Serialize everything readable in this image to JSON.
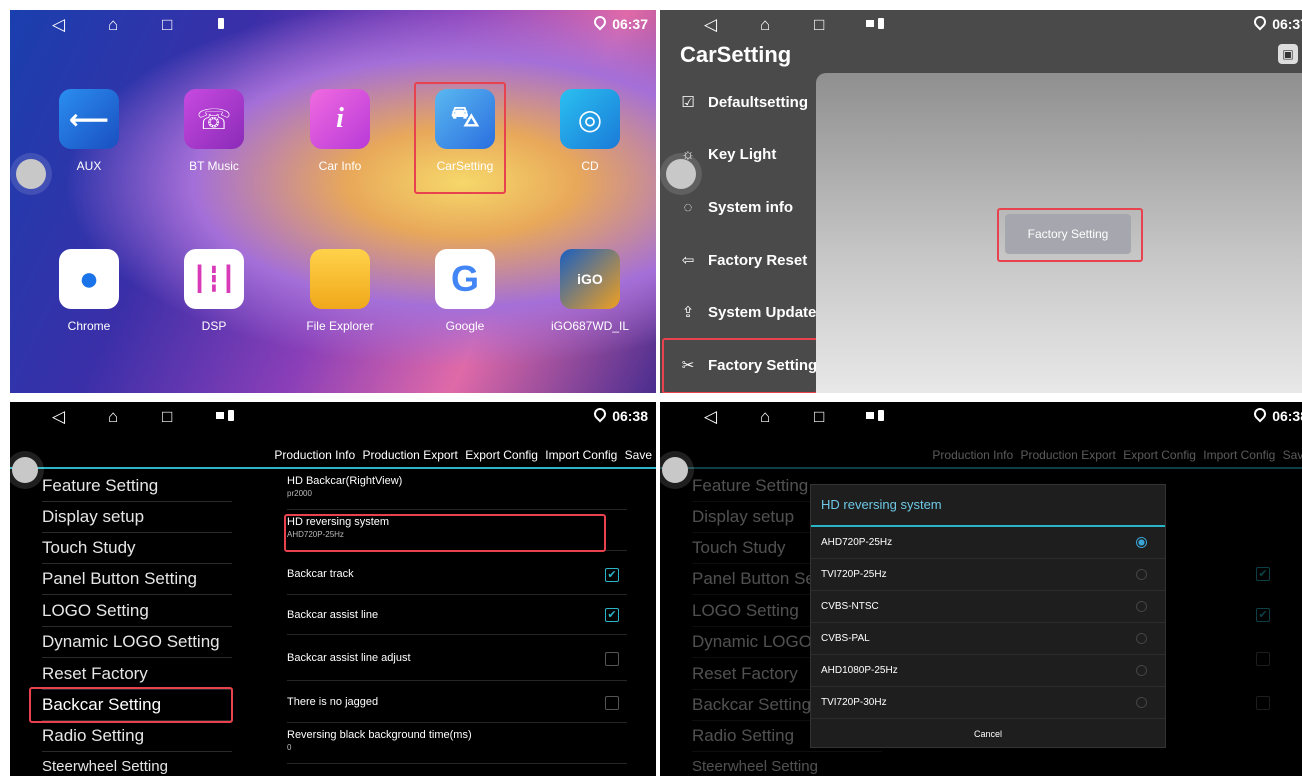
{
  "status": {
    "time_top_left": "06:37",
    "time_top_right": "06:37",
    "time_bottom_left": "06:38",
    "time_bottom_right": "06:38"
  },
  "launcher": {
    "apps": [
      {
        "label": "AUX",
        "icon": "aux-icon",
        "color": "#1e6fd8"
      },
      {
        "label": "BT Music",
        "icon": "bluetooth-music-icon",
        "color": "#b83ad0"
      },
      {
        "label": "Car Info",
        "icon": "info-icon",
        "color": "#d84ad8"
      },
      {
        "label": "CarSetting",
        "icon": "car-icon",
        "color": "#3a8ee8"
      },
      {
        "label": "CD",
        "icon": "cd-icon",
        "color": "#1aa6d8"
      },
      {
        "label": "Chrome",
        "icon": "chrome-icon",
        "color": "#ffffff"
      },
      {
        "label": "DSP",
        "icon": "equalizer-icon",
        "color": "#ffffff"
      },
      {
        "label": "File Explorer",
        "icon": "folder-icon",
        "color": "#f6b623"
      },
      {
        "label": "Google",
        "icon": "google-icon",
        "color": "#ffffff"
      },
      {
        "label": "iGO687WD_IL",
        "icon": "igo-icon",
        "color": "#2a7ed8"
      }
    ]
  },
  "carsetting": {
    "title": "CarSetting",
    "menu": [
      {
        "label": "Defaultsetting",
        "icon": "checkbox-icon",
        "glyph": "☑"
      },
      {
        "label": "Key Light",
        "icon": "sun-icon",
        "glyph": "☼"
      },
      {
        "label": "System info",
        "icon": "chat-icon",
        "glyph": "◌"
      },
      {
        "label": "Factory Reset",
        "icon": "reply-icon",
        "glyph": "⇦"
      },
      {
        "label": "System Update",
        "icon": "upload-icon",
        "glyph": "⇪"
      },
      {
        "label": "Factory Setting",
        "icon": "tools-icon",
        "glyph": "✂"
      }
    ],
    "button": "Factory Setting"
  },
  "factory": {
    "tabs": [
      "Production Info",
      "Production Export",
      "Export Config",
      "Import Config",
      "Save"
    ],
    "left_menu": [
      "Feature Setting",
      "Display setup",
      "Touch Study",
      "Panel Button Setting",
      "LOGO Setting",
      "Dynamic LOGO Setting",
      "Reset Factory",
      "Backcar Setting",
      "Radio Setting",
      "Steerwheel Setting"
    ],
    "rows": [
      {
        "title": "HD Backcar(RightView)",
        "sub": "pr2000"
      },
      {
        "title": "HD reversing system",
        "sub": "AHD720P-25Hz"
      },
      {
        "title": "Backcar track",
        "sub": ""
      },
      {
        "title": "Backcar assist line",
        "sub": ""
      },
      {
        "title": "Backcar assist line adjust",
        "sub": ""
      },
      {
        "title": "There is no jagged",
        "sub": ""
      },
      {
        "title": "Reversing black background time(ms)",
        "sub": "0"
      }
    ]
  },
  "dialog": {
    "title": "HD reversing system",
    "options": [
      "AHD720P-25Hz",
      "TVI720P-25Hz",
      "CVBS-NTSC",
      "CVBS-PAL",
      "AHD1080P-25Hz",
      "TVI720P-30Hz"
    ],
    "selected": "AHD720P-25Hz",
    "cancel": "Cancel"
  }
}
